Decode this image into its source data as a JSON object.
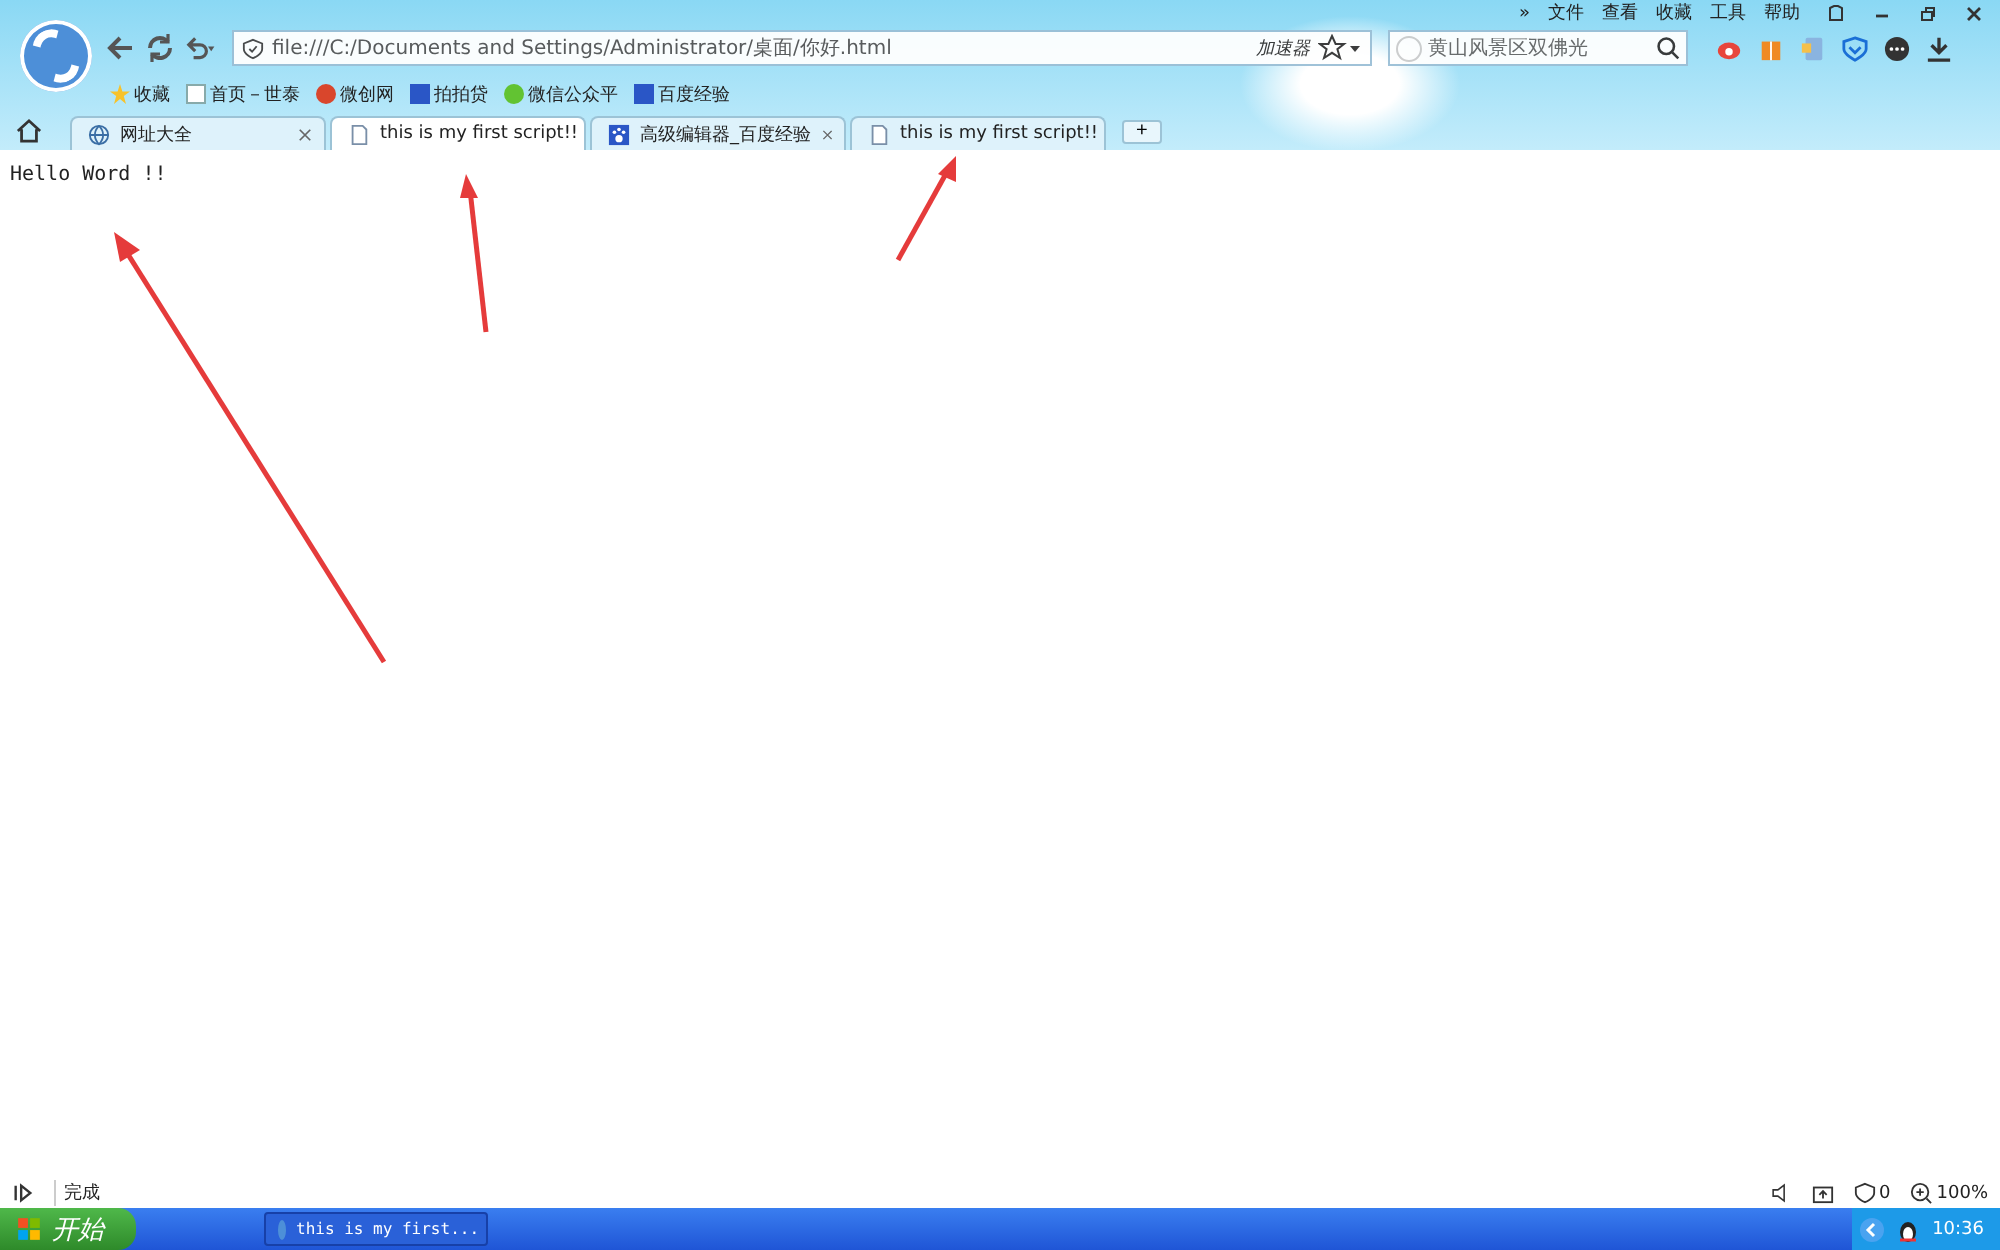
{
  "menu": [
    "»",
    "文件",
    "查看",
    "收藏",
    "工具",
    "帮助"
  ],
  "address": {
    "value": "file:///C:/Documents and Settings/Administrator/桌面/你好.html",
    "accelerator": "加速器"
  },
  "search": {
    "placeholder": "黄山风景区双佛光"
  },
  "bookmarks": [
    "收藏",
    "首页－世泰",
    "微创网",
    "拍拍贷",
    "微信公众平",
    "百度经验"
  ],
  "tabs": [
    {
      "label": "网址大全",
      "kind": "globe",
      "selected": false
    },
    {
      "label": "this is my first script!!",
      "kind": "page",
      "selected": true
    },
    {
      "label": "高级编辑器_百度经验",
      "kind": "paw",
      "selected": false
    },
    {
      "label": "this is my first script!!",
      "kind": "page",
      "selected": false
    }
  ],
  "new_tab": "+",
  "page_text": "Hello Word !!",
  "status_bar": {
    "text": "完成",
    "counter": "0",
    "zoom": "100%"
  },
  "taskbar": {
    "start": "开始",
    "task": "this is my first...",
    "clock": "10:36"
  }
}
